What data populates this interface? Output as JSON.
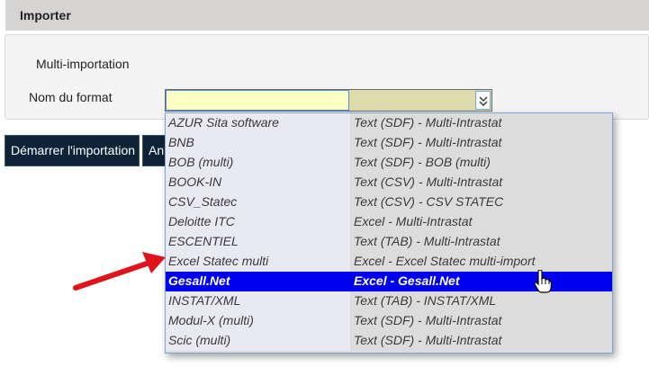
{
  "section": {
    "title": "Importer"
  },
  "form": {
    "multi_label": "Multi-importation",
    "format_label": "Nom du format",
    "format_value": ""
  },
  "buttons": {
    "start_label": "Démarrer l'importation",
    "cancel_label": "An"
  },
  "dropdown": {
    "selected_index": 8,
    "options": [
      {
        "name": "AZUR Sita software",
        "type": "Text (SDF) - Multi-Intrastat"
      },
      {
        "name": "BNB",
        "type": "Text (SDF) - Multi-Intrastat"
      },
      {
        "name": "BOB (multi)",
        "type": "Text (SDF) - BOB (multi)"
      },
      {
        "name": "BOOK-IN",
        "type": "Text (CSV) - Multi-Intrastat"
      },
      {
        "name": "CSV_Statec",
        "type": "Text (CSV) - CSV STATEC"
      },
      {
        "name": "Deloitte ITC",
        "type": "Excel - Multi-Intrastat"
      },
      {
        "name": "ESCENTIEL",
        "type": "Text (TAB) - Multi-Intrastat"
      },
      {
        "name": "Excel Statec multi",
        "type": "Excel - Excel Statec multi-import"
      },
      {
        "name": "Gesall.Net",
        "type": "Excel - Gesall.Net"
      },
      {
        "name": "INSTAT/XML",
        "type": "Text (TAB) - INSTAT/XML"
      },
      {
        "name": "Modul-X (multi)",
        "type": "Text (SDF) - Multi-Intrastat"
      },
      {
        "name": "Scic (multi)",
        "type": "Text (SDF) - Multi-Intrastat"
      }
    ]
  },
  "colors": {
    "header_bg": "#d6d3d3",
    "input_bg": "#ffffc4",
    "selected_bg": "#0000f0",
    "button_bg": "#0d2438",
    "arrow": "#e0141b"
  },
  "icons": {
    "dropdown_toggle": "chevron-down-double-icon",
    "annotation": "red-arrow-icon",
    "pointer": "hand-cursor-icon"
  }
}
